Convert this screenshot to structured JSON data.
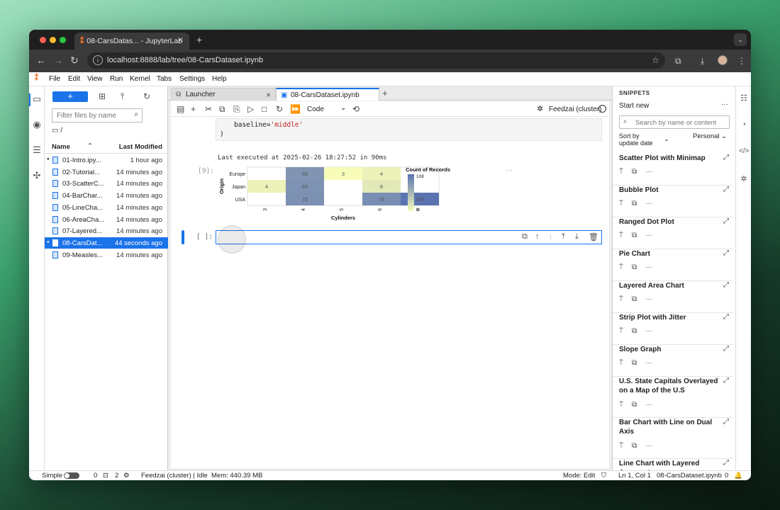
{
  "browser": {
    "tab_title": "08-CarsDatas... - JupyterLab",
    "url": "localhost:8888/lab/tree/08-CarsDataset.ipynb"
  },
  "menubar": [
    "File",
    "Edit",
    "View",
    "Run",
    "Kernel",
    "Tabs",
    "Settings",
    "Help"
  ],
  "filebrowser": {
    "filter_placeholder": "Filter files by name",
    "path": "/",
    "col_name": "Name",
    "col_modified": "Last Modified",
    "files": [
      {
        "name": "01-Intro.ipy...",
        "modified": "1 hour ago",
        "running": true,
        "selected": false
      },
      {
        "name": "02-Tutorial...",
        "modified": "14 minutes ago",
        "running": false,
        "selected": false
      },
      {
        "name": "03-ScatterC...",
        "modified": "14 minutes ago",
        "running": false,
        "selected": false
      },
      {
        "name": "04-BarChar...",
        "modified": "14 minutes ago",
        "running": false,
        "selected": false
      },
      {
        "name": "05-LineCha...",
        "modified": "14 minutes ago",
        "running": false,
        "selected": false
      },
      {
        "name": "06-AreaCha...",
        "modified": "14 minutes ago",
        "running": false,
        "selected": false
      },
      {
        "name": "07-Layered...",
        "modified": "14 minutes ago",
        "running": false,
        "selected": false
      },
      {
        "name": "08-CarsDat...",
        "modified": "44 seconds ago",
        "running": true,
        "selected": true
      },
      {
        "name": "09-Measles...",
        "modified": "14 minutes ago",
        "running": false,
        "selected": false
      }
    ]
  },
  "doctabs": [
    {
      "label": "Launcher",
      "active": false
    },
    {
      "label": "08-CarsDataset.ipynb",
      "active": true
    }
  ],
  "notebook": {
    "cell_type": "Code",
    "kernel": "Feedzai (cluster)",
    "code_line1_pre": "baseline=",
    "code_line1_str": "'middle'",
    "code_line2": ")",
    "last_executed": "Last executed at 2025-02-26 18:27:52 in 90ms",
    "out_prompt": "[9]:",
    "in_prompt": "[ ]:",
    "output_menu": "···"
  },
  "chart_data": {
    "type": "heatmap",
    "xlabel": "Cylinders",
    "ylabel": "Origin",
    "x_categories": [
      "3",
      "4",
      "5",
      "6",
      "8"
    ],
    "y_categories": [
      "Europe",
      "Japan",
      "USA"
    ],
    "cells": [
      {
        "x": "4",
        "y": "Europe",
        "value": 66
      },
      {
        "x": "5",
        "y": "Europe",
        "value": 3
      },
      {
        "x": "6",
        "y": "Europe",
        "value": 4
      },
      {
        "x": "3",
        "y": "Japan",
        "value": 4
      },
      {
        "x": "4",
        "y": "Japan",
        "value": 69
      },
      {
        "x": "6",
        "y": "Japan",
        "value": 6
      },
      {
        "x": "4",
        "y": "USA",
        "value": 72
      },
      {
        "x": "6",
        "y": "USA",
        "value": 74
      },
      {
        "x": "8",
        "y": "USA",
        "value": 108
      }
    ],
    "legend": {
      "title": "Count of Records",
      "max_label": "108",
      "min_label": "3",
      "min": 3,
      "max": 108
    },
    "colors": {
      "low": "#f7fcb9",
      "high": "#5b74b1"
    }
  },
  "snippets": {
    "title": "SNIPPETS",
    "start": "Start new",
    "search_placeholder": "Search by name or content",
    "sort_label_1": "Sort by",
    "sort_label_2": "update date",
    "filter": "Personal",
    "items": [
      "Scatter Plot with Minimap",
      "Bubble Plot",
      "Ranged Dot Plot",
      "Pie Chart",
      "Layered Area Chart",
      "Strip Plot with Jitter",
      "Slope Graph",
      "U.S. State Capitals Overlayed on a Map of the U.S",
      "Bar Chart with Line on Dual Axis",
      "Line Chart with Layered Aggregates"
    ]
  },
  "statusbar": {
    "mode_label": "Simple",
    "terminals": "0",
    "kernels": "2",
    "kernel_status": "Feedzai (cluster) | Idle",
    "memory": "Mem: 440.39 MB",
    "mode": "Mode: Edit",
    "position": "Ln 1, Col 1",
    "file": "08-CarsDataset.ipynb",
    "notifications": "0"
  }
}
